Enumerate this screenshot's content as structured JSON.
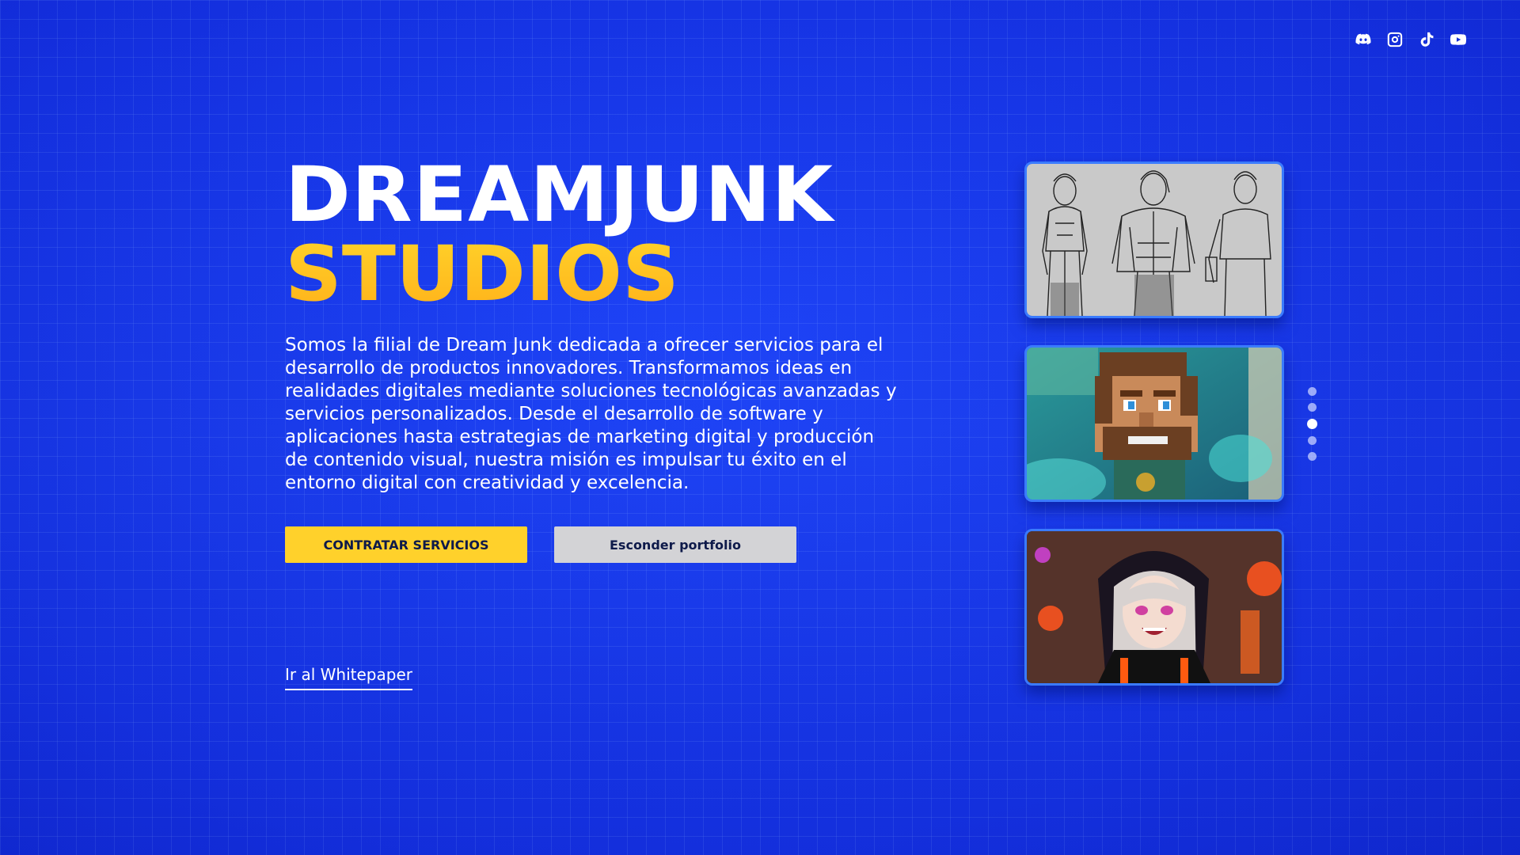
{
  "hero": {
    "title_line_1": "DREAMJUNK",
    "title_line_2": "STUDIOS",
    "description": "Somos la filial de Dream Junk dedicada a ofrecer servicios para el desarrollo de productos innovadores. Transformamos ideas en realidades digitales mediante soluciones tecnológicas avanzadas y servicios personalizados. Desde el desarrollo de software y aplicaciones hasta estrategias de marketing digital y producción de contenido visual, nuestra misión es impulsar tu éxito en el entorno digital con creatividad y excelencia."
  },
  "actions": {
    "primary_label": "CONTRATAR SERVICIOS",
    "secondary_label": "Esconder portfolio"
  },
  "links": {
    "whitepaper": "Ir al Whitepaper"
  },
  "socials": [
    "discord-icon",
    "instagram-icon",
    "tiktok-icon",
    "youtube-icon"
  ],
  "portfolio": {
    "cards": [
      "sketch-characters",
      "voxel-character",
      "anime-character"
    ],
    "carousel": {
      "count": 5,
      "active_index": 2
    }
  },
  "colors": {
    "background": "#1a3ff0",
    "title_white": "#ffffff",
    "title_accent": "#ffbd1f",
    "primary_button": "#ffd12b",
    "secondary_button": "#d3d3d6",
    "card_border": "#3a7bff"
  }
}
